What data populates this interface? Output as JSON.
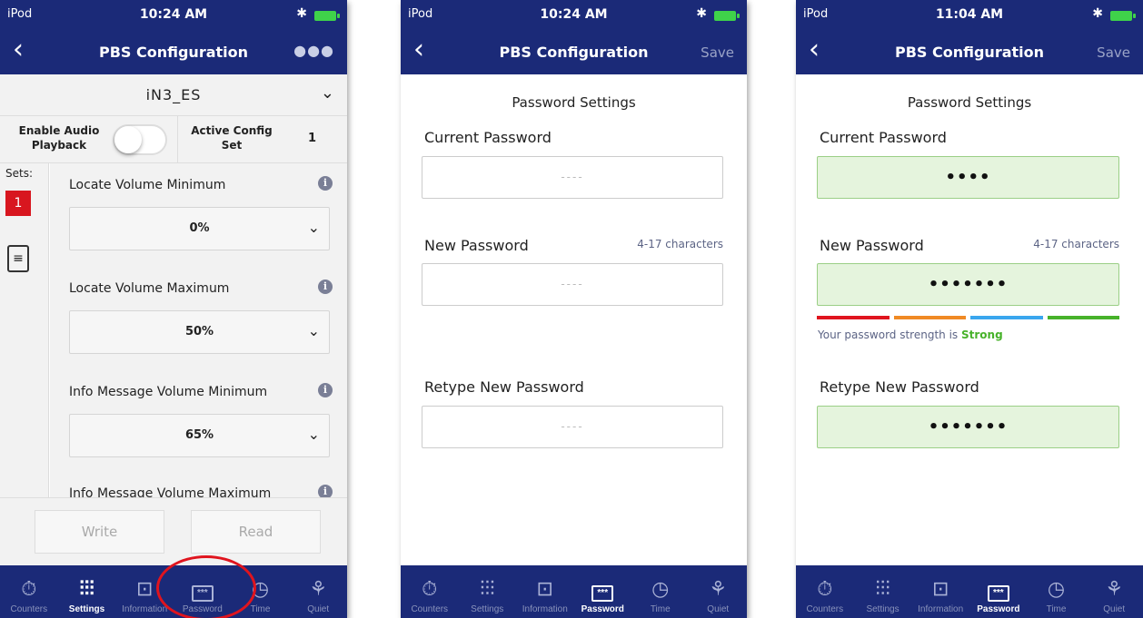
{
  "status": {
    "carrier": "iPod",
    "time_1": "10:24 AM",
    "time_2": "10:24 AM",
    "time_3": "11:04 AM"
  },
  "nav": {
    "title": "PBS Configuration",
    "save": "Save"
  },
  "config": {
    "selected": "iN3_ES",
    "enable_audio_label": "Enable Audio Playback",
    "active_config_label": "Active Config Set",
    "active_config_value": "1",
    "sets_label": "Sets:",
    "set_number": "1",
    "items": [
      {
        "name": "Locate Volume Minimum",
        "value": "0%"
      },
      {
        "name": "Locate Volume Maximum",
        "value": "50%"
      },
      {
        "name": "Info Message Volume Minimum",
        "value": "65%"
      },
      {
        "name": "Info Message Volume Maximum",
        "value": ""
      }
    ],
    "write": "Write",
    "read": "Read"
  },
  "tabs": [
    "Counters",
    "Settings",
    "Information",
    "Password",
    "Time",
    "Quiet"
  ],
  "password": {
    "heading": "Password Settings",
    "current_label": "Current Password",
    "new_label": "New Password",
    "hint": "4-17 characters",
    "retype_label": "Retype New Password",
    "placeholder": "----",
    "current_value": "••••",
    "new_value": "•••••••",
    "retype_value": "•••••••",
    "strength_prefix": "Your password strength is",
    "strength_value": "Strong"
  },
  "colors": {
    "nav": "#1b2a78",
    "badge": "#d8161f",
    "strength": [
      "#e0141e",
      "#f08a24",
      "#3aa6ee",
      "#47b22a"
    ]
  }
}
